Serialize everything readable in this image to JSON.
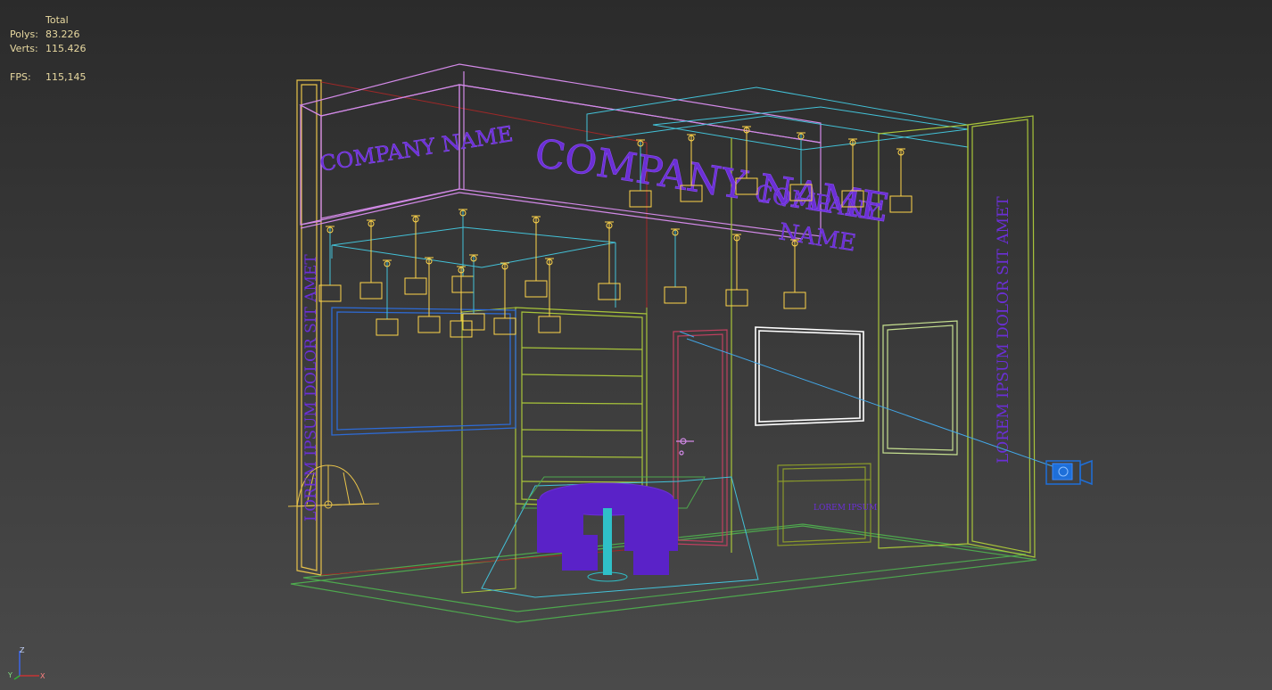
{
  "viewport": {
    "name": "3D Perspective Viewport",
    "background": "#3a3a3a"
  },
  "stats": {
    "header": "Total",
    "polys_label": "Polys:",
    "polys_value": "83.226",
    "verts_label": "Verts:",
    "verts_value": "115.426",
    "fps_label": "FPS:",
    "fps_value": "115,145",
    "text_color": "#e8d9a0"
  },
  "scene": {
    "sign_left": "COMPANY NAME",
    "sign_main": "COMPANY NAME",
    "sign_right_1": "COMPANY",
    "sign_right_2": "NAME",
    "pillar_left_text": "LOREM IPSUM DOLOR SIT AMET",
    "pillar_right_text": "LOREM IPSUM DOLOR SIT AMET",
    "counter_text": "LOREM IPSUM",
    "colors": {
      "logo": "#6b2fd6",
      "lights": "#ffd54a",
      "truss": "#d38ae8",
      "floor": "#4ea84e",
      "walls": "#a8c43a",
      "camera": "#1e6fd9",
      "screen": "#ffffff",
      "door": "#c04060"
    }
  },
  "axis": {
    "z_label": "Z",
    "x_label": "X",
    "y_label": "Y"
  }
}
